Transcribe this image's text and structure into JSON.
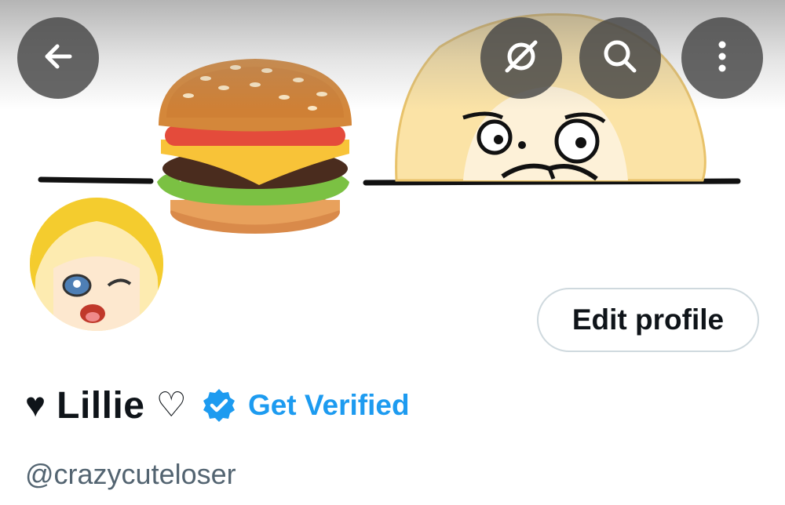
{
  "header": {
    "back_icon": "back-arrow-icon",
    "grok_icon": "grok-icon",
    "search_icon": "search-icon",
    "more_icon": "more-vertical-icon"
  },
  "banner": {
    "description_icons": [
      "hamburger-emoji",
      "sketch-character"
    ]
  },
  "profile": {
    "display_name": "Lillie",
    "heart_left": "♥",
    "heart_right": "♡",
    "verify_cta": "Get Verified",
    "handle": "@crazycuteloser",
    "edit_profile_label": "Edit profile"
  },
  "colors": {
    "accent": "#1d9bf0",
    "handle_text": "#536471",
    "button_border": "#cfd9de"
  }
}
